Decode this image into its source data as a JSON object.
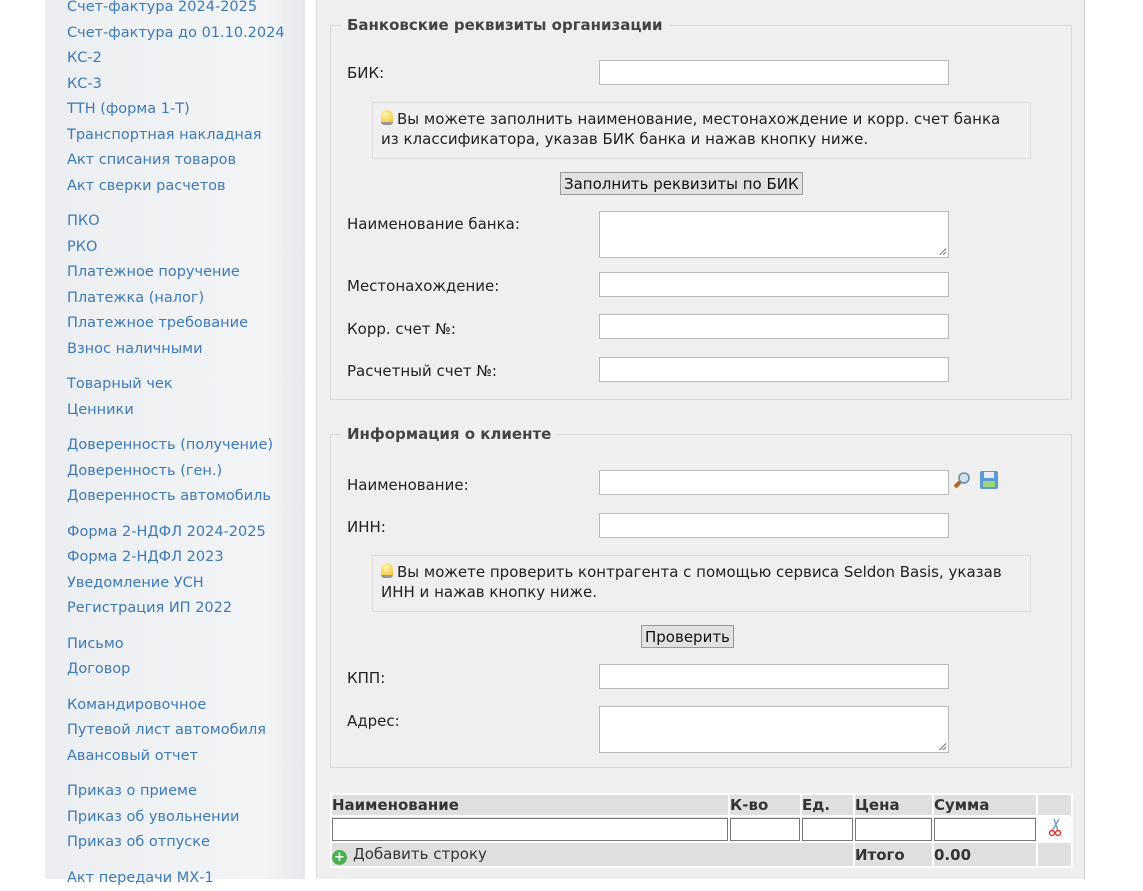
{
  "sidebar": {
    "groups": [
      [
        "Счет-фактура 2024-2025",
        "Счет-фактура до 01.10.2024",
        "КС-2",
        "КС-3",
        "ТТН (форма 1-Т)",
        "Транспортная накладная",
        "Акт списания товаров",
        "Акт сверки расчетов"
      ],
      [
        "ПКО",
        "РКО",
        "Платежное поручение",
        "Платежка (налог)",
        "Платежное требование",
        "Взнос наличными"
      ],
      [
        "Товарный чек",
        "Ценники"
      ],
      [
        "Доверенность (получение)",
        "Доверенность (ген.)",
        "Доверенность автомобиль"
      ],
      [
        "Форма 2-НДФЛ 2024-2025",
        "Форма 2-НДФЛ 2023",
        "Уведомление УСН",
        "Регистрация ИП 2022"
      ],
      [
        "Письмо",
        "Договор"
      ],
      [
        "Командировочное",
        "Путевой лист автомобиля",
        "Авансовый отчет"
      ],
      [
        "Приказ о приеме",
        "Приказ об увольнении",
        "Приказ об отпуске"
      ],
      [
        "Акт передачи МХ-1"
      ]
    ]
  },
  "bank": {
    "legend": "Банковские реквизиты организации",
    "bik": "БИК:",
    "hint": "Вы можете заполнить наименование, местонахождение и корр. счет банка из классификатора, указав БИК банка и нажав кнопку ниже.",
    "fill_button": "Заполнить реквизиты по БИК",
    "bank_name": "Наименование банка:",
    "location": "Местонахождение:",
    "corr": "Корр. счет №:",
    "account": "Расчетный счет №:"
  },
  "client": {
    "legend": "Информация о клиенте",
    "name": "Наименование:",
    "inn": "ИНН:",
    "hint": "Вы можете проверить контрагента с помощью сервиса Seldon Basis, указав ИНН и нажав кнопку ниже.",
    "check_button": "Проверить",
    "kpp": "КПП:",
    "address": "Адрес:"
  },
  "items": {
    "headers": [
      "Наименование",
      "К-во",
      "Ед.",
      "Цена",
      "Сумма"
    ],
    "add_row": "Добавить строку",
    "total_label": "Итого",
    "total": "0.00"
  }
}
